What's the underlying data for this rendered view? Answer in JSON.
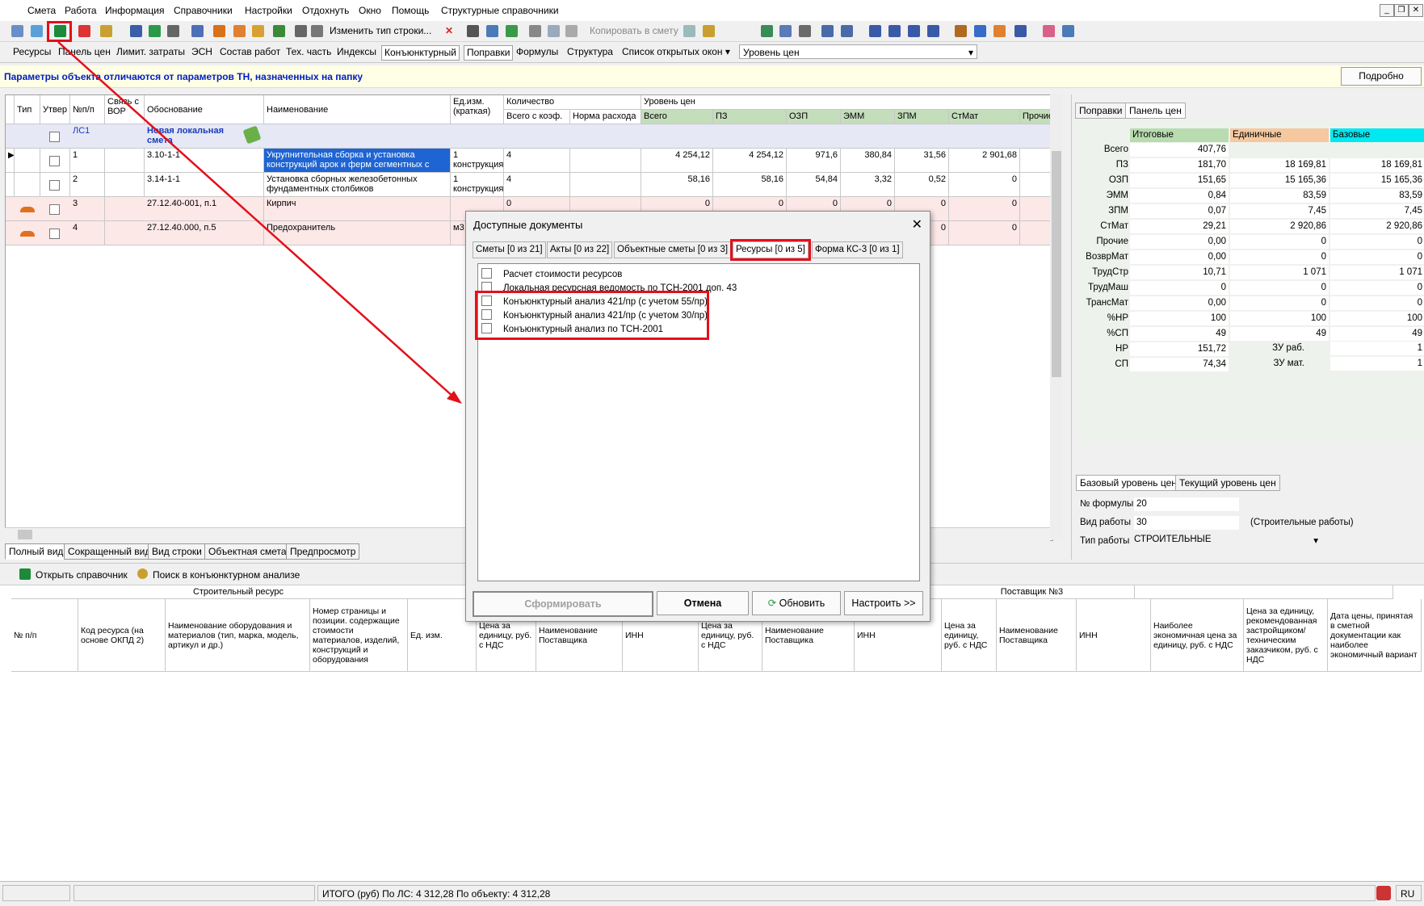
{
  "menu": [
    "Смета",
    "Работа",
    "Информация",
    "Справочники",
    "Настройки",
    "Отдохнуть",
    "Окно",
    "Помощь",
    "Структурные справочники"
  ],
  "toolbar": {
    "change_row_type": "Изменить тип строки...",
    "copy_to_estimate": "Копировать в смету"
  },
  "tabs2": [
    "Ресурсы",
    "Панель цен",
    "Лимит. затраты",
    "ЭСН",
    "Состав работ",
    "Тех. часть",
    "Индексы",
    "Конъюнктурный",
    "Поправки",
    "Формулы",
    "Структура",
    "Список открытых окон"
  ],
  "price_level_label": "Уровень цен",
  "info": {
    "message": "Параметры объекта отличаются от параметров ТН, назначенных на папку",
    "details_button": "Подробно"
  },
  "grid": {
    "headers": {
      "type": "Тип",
      "approved": "Утвер",
      "num": "№п/п",
      "vor": "Связь с ВОР",
      "basis": "Обоснование",
      "name": "Наименование",
      "unit": "Ед.изм. (краткая)",
      "qty": "Количество",
      "qty_total": "Всего с коэф.",
      "qty_norm": "Норма расхода",
      "price": "Уровень цен",
      "total": "Всего",
      "pz": "ПЗ",
      "ozp": "ОЗП",
      "emm": "ЭММ",
      "zpm": "ЗПМ",
      "stmat": "СтМат",
      "other": "Прочие"
    },
    "section": {
      "num": "ЛС1",
      "basis": "Новая локальная смета"
    },
    "rows": [
      {
        "num": "1",
        "basis": "3.10-1-1",
        "name": "Укрупнительная сборка и установка конструкций арок и ферм сегментных с",
        "unit": "1 конструкция",
        "qty": "4",
        "total": "4 254,12",
        "pz": "4 254,12",
        "ozp": "971,6",
        "emm": "380,84",
        "zpm": "31,56",
        "stmat": "2 901,68"
      },
      {
        "num": "2",
        "basis": "3.14-1-1",
        "name": "Установка сборных железобетонных фундаментных столбиков",
        "unit": "1 конструкция",
        "qty": "4",
        "total": "58,16",
        "pz": "58,16",
        "ozp": "54,84",
        "emm": "3,32",
        "zpm": "0,52",
        "stmat": "0"
      },
      {
        "num": "3",
        "basis": "27.12.40-001, п.1",
        "name": "Кирпич",
        "unit": "",
        "qty": "0",
        "total": "0",
        "pz": "0",
        "ozp": "0",
        "emm": "0",
        "zpm": "0",
        "stmat": "0"
      },
      {
        "num": "4",
        "basis": "27.12.40.000, п.5",
        "name": "Предохранитель",
        "unit": "м3",
        "qty": "",
        "total": "",
        "pz": "",
        "ozp": "",
        "emm": "",
        "zpm": "0",
        "stmat": "0"
      }
    ]
  },
  "bottom_tabs": [
    "Полный вид",
    "Сокращенный вид",
    "Вид строки",
    "Объектная смета",
    "Предпросмотр"
  ],
  "right_panel": {
    "tabs": [
      "Поправки",
      "Панель цен"
    ],
    "col_headers": [
      "Итоговые",
      "Единичные",
      "Базовые"
    ],
    "rows": [
      {
        "label": "Всего",
        "v": [
          "407,76",
          "",
          ""
        ]
      },
      {
        "label": "ПЗ",
        "v": [
          "181,70",
          "18 169,81",
          "18 169,81"
        ]
      },
      {
        "label": "ОЗП",
        "v": [
          "151,65",
          "15 165,36",
          "15 165,36"
        ]
      },
      {
        "label": "ЭММ",
        "v": [
          "0,84",
          "83,59",
          "83,59"
        ]
      },
      {
        "label": "ЗПМ",
        "v": [
          "0,07",
          "7,45",
          "7,45"
        ]
      },
      {
        "label": "СтМат",
        "v": [
          "29,21",
          "2 920,86",
          "2 920,86"
        ]
      },
      {
        "label": "Прочие",
        "v": [
          "0,00",
          "0",
          "0"
        ]
      },
      {
        "label": "ВозврМат",
        "v": [
          "0,00",
          "0",
          "0"
        ]
      },
      {
        "label": "ТрудСтр",
        "v": [
          "10,71",
          "1 071",
          "1 071"
        ]
      },
      {
        "label": "ТрудМаш",
        "v": [
          "0",
          "0",
          "0"
        ]
      },
      {
        "label": "ТрансМат",
        "v": [
          "0,00",
          "0",
          "0"
        ]
      },
      {
        "label": "%НР",
        "v": [
          "100",
          "100",
          "100"
        ]
      },
      {
        "label": "%СП",
        "v": [
          "49",
          "49",
          "49"
        ]
      },
      {
        "label": "НР",
        "v": [
          "151,72",
          "",
          ""
        ]
      },
      {
        "label": "СП",
        "v": [
          "74,34",
          "",
          ""
        ]
      }
    ],
    "zu_rab_label": "ЗУ раб.",
    "zu_rab": "1",
    "zu_mat_label": "ЗУ мат.",
    "zu_mat": "1",
    "level_tabs": [
      "Базовый уровень цен",
      "Текущий уровень цен"
    ],
    "formula_label": "№ формулы",
    "formula": "20",
    "work_kind_label": "Вид работы",
    "work_kind": "30",
    "work_kind_desc": "(Строительные работы)",
    "work_type_label": "Тип работы",
    "work_type": "СТРОИТЕЛЬНЫЕ"
  },
  "lower": {
    "open_ref": "Открыть справочник",
    "search": "Поиск в конъюнктурном анализе",
    "group1": "Строительный ресурс",
    "group3": "Поставщик №3",
    "cols": [
      "№ п/п",
      "Код ресурса (на основе ОКПД 2)",
      "Наименование оборудования и материалов (тип, марка, модель, артикул и др.)",
      "Номер страницы и позиции. содержащие стоимости материалов, изделий, конструкций и оборудования",
      "Ед. изм.",
      "Цена за единицу, руб. с НДС",
      "Наименование Поставщика",
      "ИНН",
      "Цена за единицу, руб. с НДС",
      "Наименование Поставщика",
      "ИНН",
      "Цена за единицу, руб. с НДС",
      "Наименование Поставщика",
      "ИНН",
      "Наиболее экономичная цена за единицу, руб. с НДС",
      "Цена за единицу, рекомендованная застройщиком/ техническим заказчиком, руб. с НДС",
      "Дата цены, принятая в сметной документации как наиболее экономичный вариант"
    ]
  },
  "status": {
    "total": "ИТОГО (руб)  По ЛС: 4 312,28      По объекту: 4 312,28",
    "lang": "RU"
  },
  "dialog": {
    "title": "Доступные документы",
    "tabs": [
      "Сметы [0 из 21]",
      "Акты [0 из 22]",
      "Объектные сметы [0 из 3]",
      "Ресурсы [0 из 5]",
      "Форма КС-3 [0 из 1]"
    ],
    "items": [
      "Расчет стоимости ресурсов",
      "Локальная ресурсная ведомость по ТСН-2001 доп. 43",
      "Конъюнктурный анализ 421/пр (с учетом 55/пр)",
      "Конъюнктурный анализ 421/пр (с учетом 30/пр)",
      "Конъюнктурный анализ по ТСН-2001"
    ],
    "buttons": {
      "generate": "Сформировать",
      "cancel": "Отмена",
      "refresh": "Обновить",
      "setup": "Настроить >>"
    }
  },
  "colors": {
    "highlight_red": "#e3101a",
    "green_header": "#c4ddbb",
    "orange_header": "#f5c8a0",
    "cyan_header": "#00e8f0",
    "pink_row": "#fde8e8",
    "selected": "#1e64d2"
  }
}
